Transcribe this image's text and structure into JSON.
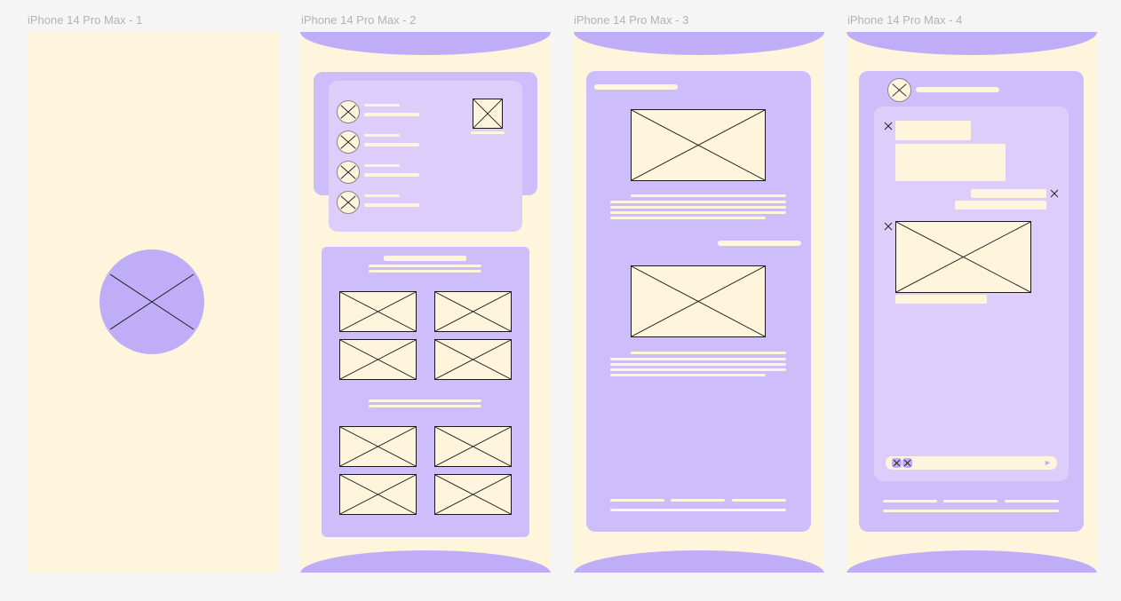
{
  "canvas": {
    "background": "#f5f5f5"
  },
  "colors": {
    "cream": "#fff4dc",
    "purple": "#bfadf8",
    "purple_light": "#cdbdfb",
    "lilac": "#ddcdfb",
    "label": "#b3b3b3"
  },
  "frames": [
    {
      "label": "iPhone 14 Pro Max - 1",
      "icon": "image-placeholder-icon"
    },
    {
      "label": "iPhone 14 Pro Max - 2",
      "icon": "image-placeholder-icon"
    },
    {
      "label": "iPhone 14 Pro Max - 3",
      "icon": "image-placeholder-icon"
    },
    {
      "label": "iPhone 14 Pro Max - 4",
      "icon": "image-placeholder-icon",
      "send_icon": "send-arrow-icon"
    }
  ],
  "send_glyph": "►"
}
